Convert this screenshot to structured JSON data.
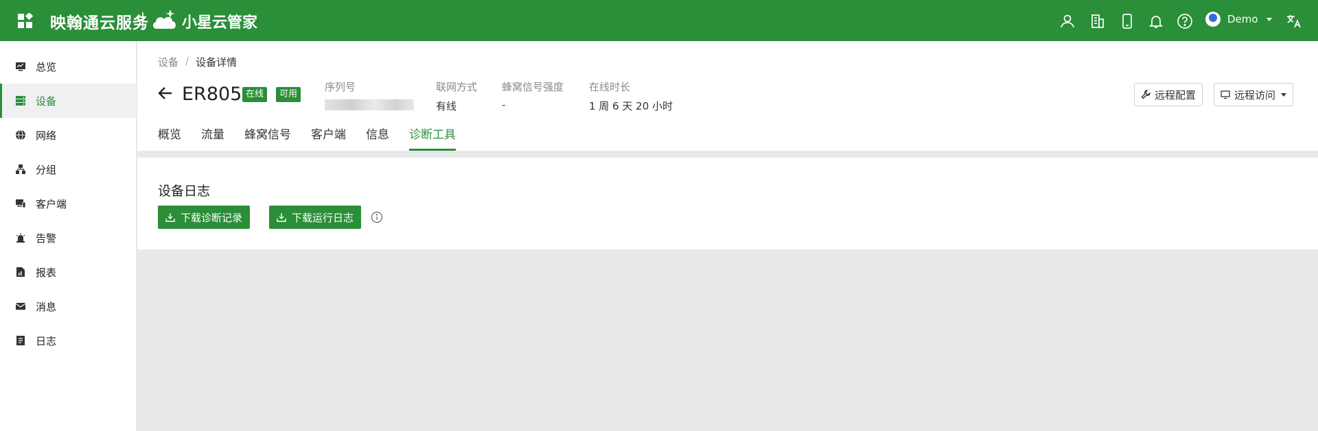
{
  "header": {
    "brand": "映翰通云服务",
    "product": "小星云管家",
    "user_name": "Demo",
    "icons": [
      "user-icon",
      "building-icon",
      "mobile-icon",
      "bell-icon",
      "help-icon",
      "translate-icon"
    ]
  },
  "sidebar": {
    "items": [
      {
        "label": "总览",
        "icon": "monitor-icon"
      },
      {
        "label": "设备",
        "icon": "server-icon",
        "active": true
      },
      {
        "label": "网络",
        "icon": "globe-icon"
      },
      {
        "label": "分组",
        "icon": "group-icon"
      },
      {
        "label": "客户端",
        "icon": "clients-icon"
      },
      {
        "label": "告警",
        "icon": "alarm-icon"
      },
      {
        "label": "报表",
        "icon": "report-icon"
      },
      {
        "label": "消息",
        "icon": "mail-icon"
      },
      {
        "label": "日志",
        "icon": "log-icon"
      }
    ]
  },
  "breadcrumb": {
    "root": "设备",
    "separator": "/",
    "current": "设备详情"
  },
  "device": {
    "name": "ER805",
    "status_online": "在线",
    "status_available": "可用",
    "serial_label": "序列号",
    "serial_value_hidden": true,
    "network_label": "联网方式",
    "network_value": "有线",
    "cellular_label": "蜂窝信号强度",
    "cellular_value": "-",
    "uptime_label": "在线时长",
    "uptime_value": "1 周 6 天 20 小时"
  },
  "actions": {
    "remote_config": "远程配置",
    "remote_access": "远程访问"
  },
  "tabs": [
    {
      "label": "概览"
    },
    {
      "label": "流量"
    },
    {
      "label": "蜂窝信号"
    },
    {
      "label": "客户端"
    },
    {
      "label": "信息"
    },
    {
      "label": "诊断工具",
      "active": true
    }
  ],
  "log_section": {
    "title": "设备日志",
    "download_diag": "下载诊断记录",
    "download_run": "下载运行日志"
  },
  "colors": {
    "brand_green": "#2a8f38",
    "background": "#e8e9eb"
  }
}
